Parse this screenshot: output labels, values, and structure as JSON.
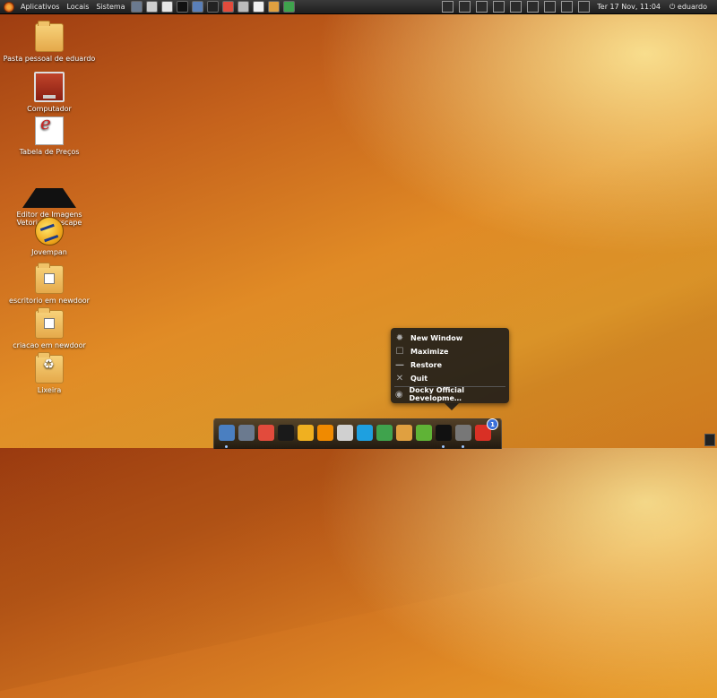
{
  "top_panel": {
    "menus": [
      "Aplicativos",
      "Locais",
      "Sistema"
    ],
    "launchers": [
      {
        "icon": "firefox-icon",
        "color": "#6b7a8f"
      },
      {
        "icon": "usb-drive-icon",
        "color": "#cfcfcf"
      },
      {
        "icon": "cloud-icon",
        "color": "#e6e6e6"
      },
      {
        "icon": "terminal-icon",
        "color": "#111111"
      },
      {
        "icon": "window-icon",
        "color": "#5a7fb8"
      },
      {
        "icon": "inkscape-icon",
        "color": "#222222"
      },
      {
        "icon": "picasa-icon",
        "color": "#e24b3c"
      },
      {
        "icon": "calculator-icon",
        "color": "#bbbbbb"
      },
      {
        "icon": "text-editor-icon",
        "color": "#f0f0f0"
      },
      {
        "icon": "contacts-icon",
        "color": "#e0a040"
      },
      {
        "icon": "messenger-icon",
        "color": "#3fa34d"
      }
    ],
    "tray": [
      "camera-icon",
      "network-graph-icon",
      "cpu-monitor-icon",
      "memory-monitor-icon",
      "screen-icon",
      "signal-icon",
      "alert-icon",
      "volume-icon",
      "mail-icon"
    ],
    "clock": "Ter 17 Nov, 11:04",
    "user": "eduardo"
  },
  "desktop_icons": [
    {
      "label": "Pasta pessoal de eduardo",
      "icon": "home-folder-icon"
    },
    {
      "label": "Computador",
      "icon": "computer-icon"
    },
    {
      "label": "Tabela de Preços",
      "icon": "document-icon"
    },
    {
      "label": "Editor de Imagens Vetoriais Inkscape",
      "icon": "inkscape-icon"
    },
    {
      "label": "Jovempan",
      "icon": "jovempan-icon"
    },
    {
      "label": "escritorio em newdoor",
      "icon": "network-folder-icon"
    },
    {
      "label": "criacao em newdoor",
      "icon": "network-folder-icon"
    },
    {
      "label": "Lixeira",
      "icon": "trash-icon"
    }
  ],
  "context_menu": {
    "items": [
      {
        "label": "New Window",
        "icon": "gear-icon"
      },
      {
        "label": "Maximize",
        "icon": "maximize-icon"
      },
      {
        "label": "Restore",
        "icon": "restore-icon"
      },
      {
        "label": "Quit",
        "icon": "close-icon"
      }
    ],
    "footer": {
      "label": "Docky Official Developme…",
      "icon": "docky-icon"
    }
  },
  "dock": {
    "items": [
      {
        "icon": "desktop-switcher-icon",
        "color": "#4a7fc1"
      },
      {
        "icon": "firefox-icon",
        "color": "#6b7a8f"
      },
      {
        "icon": "picasa-icon",
        "color": "#e24b3c"
      },
      {
        "icon": "inkscape-icon",
        "color": "#1a1a1a"
      },
      {
        "icon": "jovempan-icon",
        "color": "#f0b020"
      },
      {
        "icon": "vlc-icon",
        "color": "#f08a00"
      },
      {
        "icon": "usb-drive-icon",
        "color": "#d0d0d0"
      },
      {
        "icon": "skype-icon",
        "color": "#1ea0e0"
      },
      {
        "icon": "messenger-icon",
        "color": "#3fa34d"
      },
      {
        "icon": "contacts-icon",
        "color": "#e0a040"
      },
      {
        "icon": "virtualbox-icon",
        "color": "#5fb336"
      },
      {
        "icon": "terminal-icon",
        "color": "#111111"
      },
      {
        "icon": "docky-icon",
        "color": "#777777"
      },
      {
        "icon": "gmail-icon",
        "color": "#d93025"
      }
    ],
    "badge": "1"
  }
}
